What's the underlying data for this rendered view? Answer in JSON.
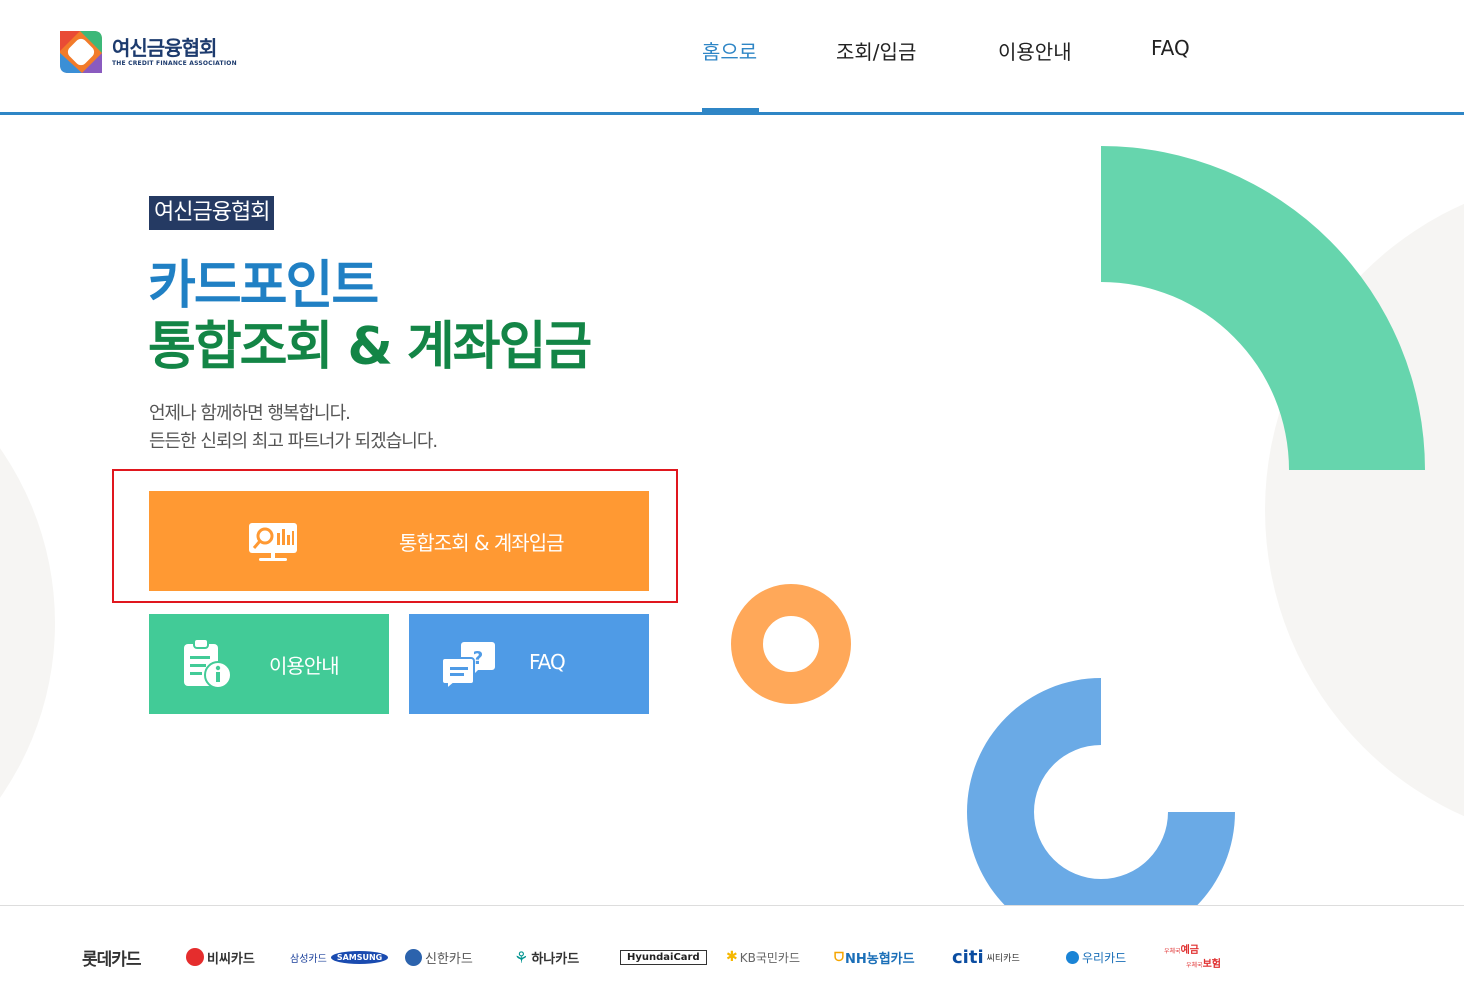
{
  "header": {
    "logo": {
      "name_ko": "여신금융협회",
      "name_en": "THE CREDIT FINANCE ASSOCIATION"
    },
    "nav": [
      {
        "label": "홈으로",
        "active": true
      },
      {
        "label": "조회/입금",
        "active": false
      },
      {
        "label": "이용안내",
        "active": false
      },
      {
        "label": "FAQ",
        "active": false
      }
    ],
    "accent_color": "#2f86c6"
  },
  "hero": {
    "badge": "여신금융협회",
    "title_line1": "카드포인트",
    "title_line2": "통합조회 & 계좌입금",
    "desc_line1": "언제나 함께하면 행복합니다.",
    "desc_line2": "든든한 신뢰의 최고 파트너가 되겠습니다."
  },
  "buttons": {
    "main": {
      "label": "통합조회 & 계좌입금",
      "icon": "presentation-search-icon",
      "color": "#ff9933"
    },
    "guide": {
      "label": "이용안내",
      "icon": "clipboard-info-icon",
      "color": "#42cb97"
    },
    "faq": {
      "label": "FAQ",
      "icon": "chat-question-icon",
      "color": "#4f9be6"
    }
  },
  "partners": [
    {
      "name": "롯데카드"
    },
    {
      "name": "비씨카드"
    },
    {
      "name": "삼성카드",
      "sub": "SAMSUNG"
    },
    {
      "name": "신한카드"
    },
    {
      "name": "하나카드"
    },
    {
      "name": "HyundaiCard"
    },
    {
      "name": "KB국민카드"
    },
    {
      "name": "NH농협카드"
    },
    {
      "name": "citi",
      "sub": "씨티카드"
    },
    {
      "name": "우리카드"
    },
    {
      "name": "예금",
      "sub": "보험",
      "prefix1": "우체국",
      "prefix2": "우체국"
    }
  ]
}
